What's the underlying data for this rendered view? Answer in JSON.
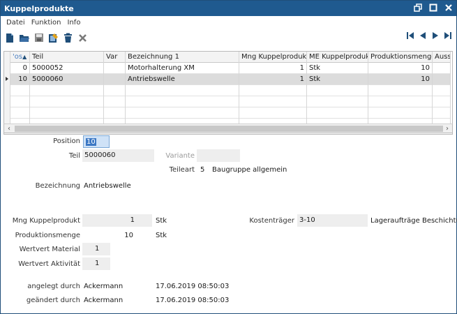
{
  "window": {
    "title": "Kuppelprodukte"
  },
  "menu": [
    "Datei",
    "Funktion",
    "Info"
  ],
  "toolbar": {
    "icons": [
      "new-document-icon",
      "open-folder-icon",
      "save-icon",
      "edit-icon",
      "delete-icon",
      "cancel-icon"
    ]
  },
  "navigation": {
    "icons": [
      "first-record-icon",
      "previous-record-icon",
      "next-record-icon",
      "last-record-icon"
    ]
  },
  "table": {
    "headers": [
      "'os",
      "Teil",
      "Var",
      "Bezeichnung 1",
      "Mng Kuppelprodukt",
      "ME Kuppelprodukt",
      "Produktionsmenge",
      "Auss"
    ],
    "rows": [
      {
        "pos": "0",
        "teil": "5000052",
        "var": "",
        "bez": "Motorhalterung XM",
        "mng": "1",
        "me": "Stk",
        "prod": "10",
        "aus": ""
      },
      {
        "pos": "10",
        "teil": "5000060",
        "var": "",
        "bez": "Antriebswelle",
        "mng": "1",
        "me": "Stk",
        "prod": "10",
        "aus": ""
      }
    ]
  },
  "form": {
    "position_label": "Position",
    "position_value": "10",
    "teil_label": "Teil",
    "teil_value": "5000060",
    "variante_label": "Variante",
    "variante_value": "",
    "teileart_label": "Teileart",
    "teileart_code": "5",
    "teileart_text": "Baugruppe allgemein",
    "bezeichnung_label": "Bezeichnung",
    "bezeichnung_value": "Antriebswelle",
    "mng_label": "Mng Kuppelprodukt",
    "mng_value": "1",
    "mng_unit": "Stk",
    "prod_label": "Produktionsmenge",
    "prod_value": "10",
    "prod_unit": "Stk",
    "kosten_label": "Kostenträger",
    "kosten_value": "3-10",
    "kosten_text": "Lageraufträge Beschichtun",
    "wm_label": "Wertvert Material",
    "wm_value": "1",
    "wa_label": "Wertvert Aktivität",
    "wa_value": "1",
    "angelegt_label": "angelegt durch",
    "angelegt_user": "Ackermann",
    "angelegt_date": "17.06.2019 08:50:03",
    "geaendert_label": "geändert durch",
    "geaendert_user": "Ackermann",
    "geaendert_date": "17.06.2019 08:50:03"
  },
  "colors": {
    "titlebar": "#1f5a8f",
    "selected_row": "#dcdcdc",
    "field_bg": "#eeeeee"
  }
}
